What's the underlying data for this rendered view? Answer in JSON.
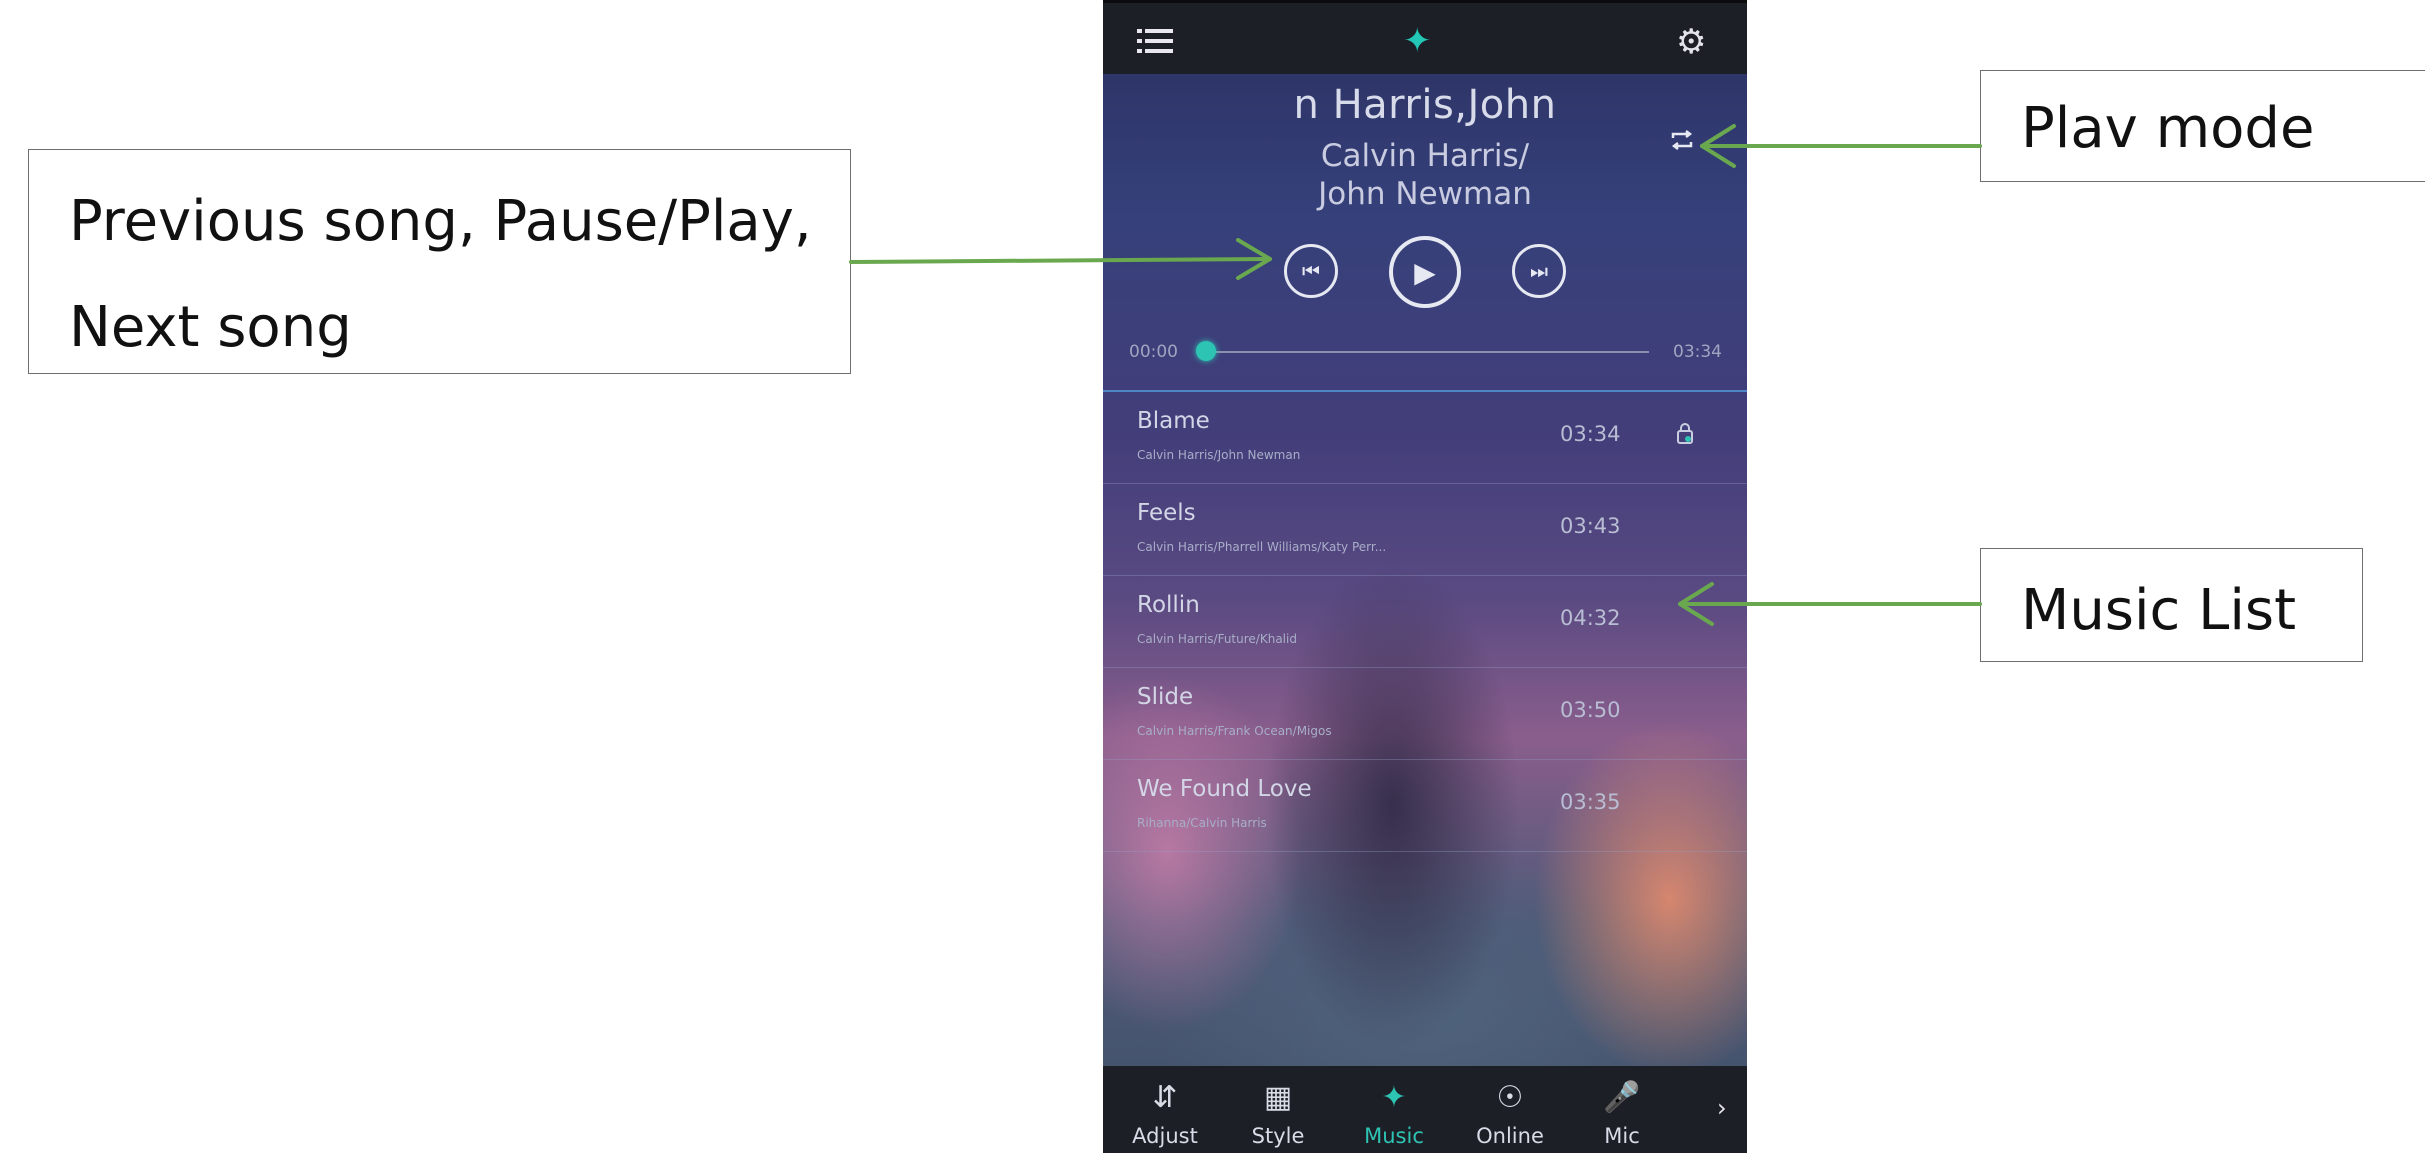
{
  "annotations": {
    "controls": {
      "line1": "Previous song, Pause/Play,",
      "line2": "Next song"
    },
    "play_mode": "Plav mode",
    "music_list": "Music List"
  },
  "player": {
    "title": "n Harris,John",
    "artist_line1": "Calvin Harris/",
    "artist_line2": "John Newman",
    "time_current": "00:00",
    "time_total": "03:34",
    "progress_fraction": 0.0,
    "accent_color": "#2ec4b3"
  },
  "tracks": [
    {
      "name": "Blame",
      "artists": "Calvin Harris/John Newman",
      "duration": "03:34",
      "playing": true
    },
    {
      "name": "Feels",
      "artists": "Calvin Harris/Pharrell Williams/Katy Perr...",
      "duration": "03:43"
    },
    {
      "name": "Rollin",
      "artists": "Calvin Harris/Future/Khalid",
      "duration": "04:32"
    },
    {
      "name": "Slide",
      "artists": "Calvin Harris/Frank Ocean/Migos",
      "duration": "03:50"
    },
    {
      "name": "We Found Love",
      "artists": "Rihanna/Calvin Harris",
      "duration": "03:35"
    }
  ],
  "tabs": [
    {
      "label": "Adjust",
      "icon": "equalizer-icon"
    },
    {
      "label": "Style",
      "icon": "grid-icon"
    },
    {
      "label": "Music",
      "icon": "music-logo-icon",
      "active": true
    },
    {
      "label": "Online",
      "icon": "online-icon"
    },
    {
      "label": "Mic",
      "icon": "microphone-icon"
    }
  ]
}
